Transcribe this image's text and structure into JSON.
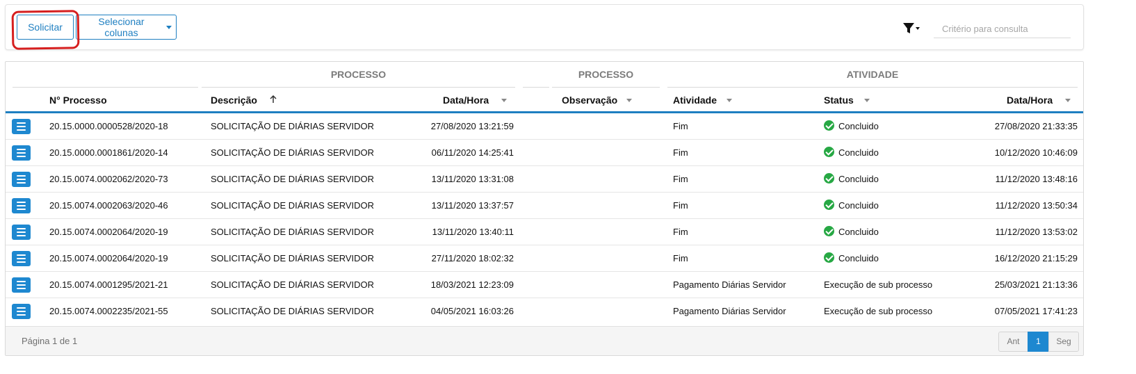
{
  "toolbar": {
    "solicitar_label": "Solicitar",
    "select_columns_label": "Selecionar colunas",
    "search_placeholder": "Critério para consulta",
    "search_value": ""
  },
  "table": {
    "group_headers": [
      "PROCESSO",
      "PROCESSO",
      "ATIVIDADE"
    ],
    "columns": [
      "N° Processo",
      "Descrição",
      "Data/Hora",
      "Observação",
      "Atividade",
      "Status",
      "Data/Hora"
    ],
    "rows": [
      {
        "numero": "20.15.0000.0000528/2020-18",
        "descricao": "SOLICITAÇÃO DE DIÁRIAS SERVIDOR",
        "data_proc": "27/08/2020 13:21:59",
        "observacao": "",
        "atividade": "Fim",
        "status": "Concluido",
        "status_icon": "check-circle-icon",
        "data_ativ": "27/08/2020 21:33:35"
      },
      {
        "numero": "20.15.0000.0001861/2020-14",
        "descricao": "SOLICITAÇÃO DE DIÁRIAS SERVIDOR",
        "data_proc": "06/11/2020 14:25:41",
        "observacao": "",
        "atividade": "Fim",
        "status": "Concluido",
        "status_icon": "check-circle-icon",
        "data_ativ": "10/12/2020 10:46:09"
      },
      {
        "numero": "20.15.0074.0002062/2020-73",
        "descricao": "SOLICITAÇÃO DE DIÁRIAS SERVIDOR",
        "data_proc": "13/11/2020 13:31:08",
        "observacao": "",
        "atividade": "Fim",
        "status": "Concluido",
        "status_icon": "check-circle-icon",
        "data_ativ": "11/12/2020 13:48:16"
      },
      {
        "numero": "20.15.0074.0002063/2020-46",
        "descricao": "SOLICITAÇÃO DE DIÁRIAS SERVIDOR",
        "data_proc": "13/11/2020 13:37:57",
        "observacao": "",
        "atividade": "Fim",
        "status": "Concluido",
        "status_icon": "check-circle-icon",
        "data_ativ": "11/12/2020 13:50:34"
      },
      {
        "numero": "20.15.0074.0002064/2020-19",
        "descricao": "SOLICITAÇÃO DE DIÁRIAS SERVIDOR",
        "data_proc": "13/11/2020 13:40:11",
        "observacao": "",
        "atividade": "Fim",
        "status": "Concluido",
        "status_icon": "check-circle-icon",
        "data_ativ": "11/12/2020 13:53:02"
      },
      {
        "numero": "20.15.0074.0002064/2020-19",
        "descricao": "SOLICITAÇÃO DE DIÁRIAS SERVIDOR",
        "data_proc": "27/11/2020 18:02:32",
        "observacao": "",
        "atividade": "Fim",
        "status": "Concluido",
        "status_icon": "check-circle-icon",
        "data_ativ": "16/12/2020 21:15:29"
      },
      {
        "numero": "20.15.0074.0001295/2021-21",
        "descricao": "SOLICITAÇÃO DE DIÁRIAS SERVIDOR",
        "data_proc": "18/03/2021 12:23:09",
        "observacao": "",
        "atividade": "Pagamento Diárias Servidor",
        "status": "Execução de sub processo",
        "status_icon": "",
        "data_ativ": "25/03/2021 21:13:36"
      },
      {
        "numero": "20.15.0074.0002235/2021-55",
        "descricao": "SOLICITAÇÃO DE DIÁRIAS SERVIDOR",
        "data_proc": "04/05/2021 16:03:26",
        "observacao": "",
        "atividade": "Pagamento Diárias Servidor",
        "status": "Execução de sub processo",
        "status_icon": "",
        "data_ativ": "07/05/2021 17:41:23"
      }
    ]
  },
  "footer": {
    "page_info": "Página 1 de 1",
    "prev_label": "Ant",
    "current_page": "1",
    "next_label": "Seg"
  },
  "colors": {
    "accent": "#1e88d0",
    "success": "#27a844",
    "highlight": "#d61f1f"
  }
}
